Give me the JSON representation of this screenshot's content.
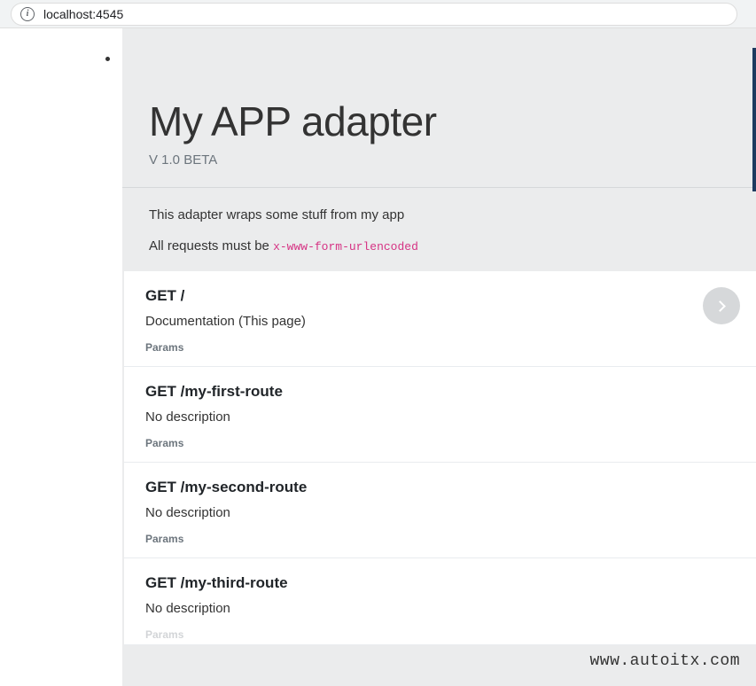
{
  "browser": {
    "url": "localhost:4545"
  },
  "header": {
    "title": "My APP adapter",
    "version": "V 1.0 BETA"
  },
  "description": {
    "line1": "This adapter wraps some stuff from my app",
    "line2_prefix": "All requests must be ",
    "line2_code": "x-www-form-urlencoded"
  },
  "routes": [
    {
      "method_path": "GET /",
      "description": "Documentation (This page)",
      "params_label": "Params",
      "has_expand": true
    },
    {
      "method_path": "GET /my-first-route",
      "description": "No description",
      "params_label": "Params",
      "has_expand": false
    },
    {
      "method_path": "GET /my-second-route",
      "description": "No description",
      "params_label": "Params",
      "has_expand": false
    },
    {
      "method_path": "GET /my-third-route",
      "description": "No description",
      "params_label": "Params",
      "has_expand": false
    }
  ],
  "watermark": "www.autoitx.com"
}
